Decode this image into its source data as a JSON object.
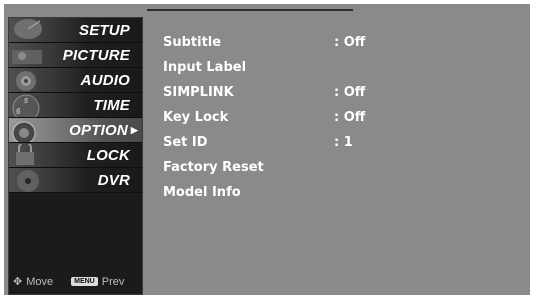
{
  "sidebar": {
    "items": [
      {
        "label": "SETUP"
      },
      {
        "label": "PICTURE"
      },
      {
        "label": "AUDIO"
      },
      {
        "label": "TIME"
      },
      {
        "label": "OPTION"
      },
      {
        "label": "LOCK"
      },
      {
        "label": "DVR"
      }
    ],
    "active_index": 4,
    "hints": {
      "move": "Move",
      "menu_key": "MENU",
      "prev": "Prev"
    }
  },
  "option_menu": {
    "rows": [
      {
        "label": "Subtitle",
        "value": ": Off"
      },
      {
        "label": "Input Label",
        "value": ""
      },
      {
        "label": "SIMPLINK",
        "value": ": Off"
      },
      {
        "label": "Key Lock",
        "value": ": Off"
      },
      {
        "label": "Set ID",
        "value": ": 1"
      },
      {
        "label": "Factory Reset",
        "value": ""
      },
      {
        "label": "Model Info",
        "value": ""
      }
    ]
  },
  "colors": {
    "panel": "#8a8a8a",
    "sidebar": "#1b1b1b",
    "text": "#ffffff"
  }
}
